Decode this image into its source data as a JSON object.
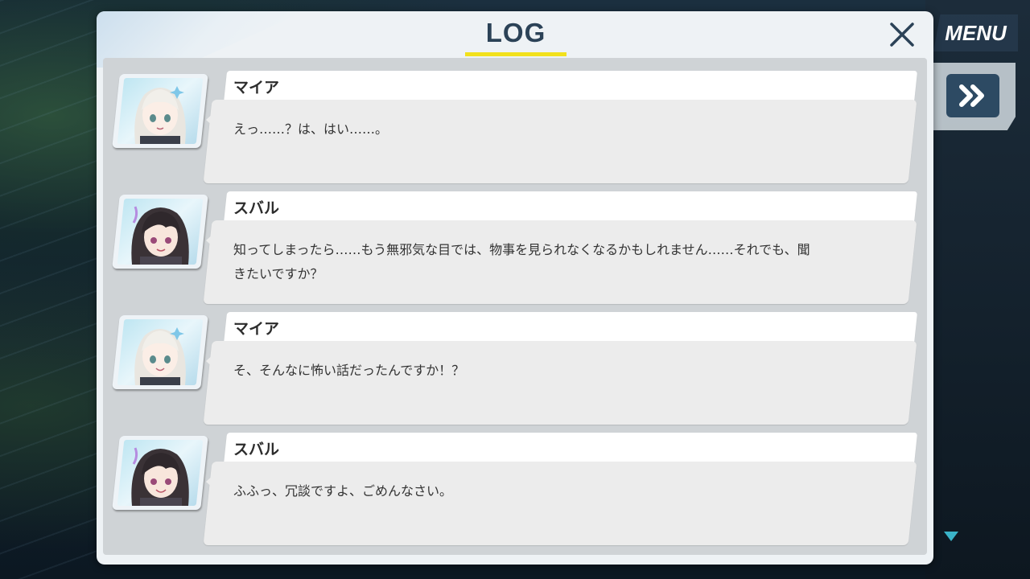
{
  "header": {
    "title": "LOG"
  },
  "menu": {
    "label": "MENU"
  },
  "controls": {
    "fast_forward_icon": "double-chevron-right-icon",
    "close_icon": "close-x-icon",
    "scroll_down_icon": "triangle-down-icon"
  },
  "colors": {
    "title": "#2b4257",
    "underline": "#f2e11c",
    "accent": "#3ab3c8"
  },
  "entries": [
    {
      "speaker": "マイア",
      "text": "えっ……？は、はい……。",
      "character": "maia"
    },
    {
      "speaker": "スバル",
      "text": "知ってしまったら……もう無邪気な目では、物事を見られなくなるかもしれません……それでも、聞きたいですか？",
      "character": "subaru"
    },
    {
      "speaker": "マイア",
      "text": "そ、そんなに怖い話だったんですか！？",
      "character": "maia"
    },
    {
      "speaker": "スバル",
      "text": "ふふっ、冗談ですよ、ごめんなさい。",
      "character": "subaru"
    }
  ]
}
